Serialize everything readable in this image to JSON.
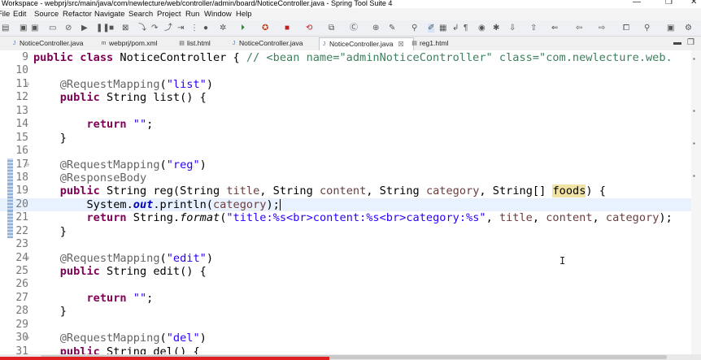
{
  "window": {
    "title": "Workspace - webprj/src/main/java/com/newlecture/web/controller/admin/board/NoticeController.java - Spring Tool Suite 4",
    "controls": [
      "—",
      "❐",
      "✕"
    ]
  },
  "menu": {
    "items": [
      "File",
      "Edit",
      "Source",
      "Refactor",
      "Navigate",
      "Search",
      "Project",
      "Run",
      "Window",
      "Help"
    ]
  },
  "tabs": [
    {
      "label": "NoticeController.java",
      "icon": "java-file-icon",
      "active": false
    },
    {
      "label": "webprj/pom.xml",
      "icon": "maven-file-icon",
      "active": false
    },
    {
      "label": "list.html",
      "icon": "html-file-icon",
      "active": false
    },
    {
      "label": "NoticeController.java",
      "icon": "java-file-icon",
      "active": false
    },
    {
      "label": "NoticeController.java",
      "icon": "java-file-icon",
      "active": true,
      "close": "☒"
    },
    {
      "label": "reg1.html",
      "icon": "html-file-icon",
      "active": false
    }
  ],
  "editor": {
    "lines": [
      {
        "no": "9",
        "fold": "",
        "mark": false,
        "cur": false,
        "tokens": [
          [
            "kw",
            "public "
          ],
          [
            "kw",
            "class "
          ],
          [
            "",
            "NoticeController { "
          ],
          [
            "cmt",
            "// <bean name=\"adminNoticeController\" class=\"com.newlecture.web."
          ]
        ]
      },
      {
        "no": "10",
        "fold": "",
        "mark": false,
        "cur": false,
        "tokens": []
      },
      {
        "no": "11",
        "fold": "⊖",
        "mark": false,
        "cur": false,
        "tokens": [
          [
            "",
            "    "
          ],
          [
            "ann",
            "@RequestMapping"
          ],
          [
            "",
            "("
          ],
          [
            "str",
            "\"list\""
          ],
          [
            "",
            ")"
          ]
        ]
      },
      {
        "no": "12",
        "fold": "",
        "mark": false,
        "cur": false,
        "tokens": [
          [
            "",
            "    "
          ],
          [
            "kw",
            "public "
          ],
          [
            "",
            "String list() {"
          ]
        ]
      },
      {
        "no": "13",
        "fold": "",
        "mark": false,
        "cur": false,
        "tokens": []
      },
      {
        "no": "14",
        "fold": "",
        "mark": false,
        "cur": false,
        "tokens": [
          [
            "",
            "        "
          ],
          [
            "kw",
            "return "
          ],
          [
            "str",
            "\"\""
          ],
          [
            "",
            ";"
          ]
        ]
      },
      {
        "no": "15",
        "fold": "",
        "mark": false,
        "cur": false,
        "tokens": [
          [
            "",
            "    }"
          ]
        ]
      },
      {
        "no": "16",
        "fold": "",
        "mark": false,
        "cur": false,
        "tokens": []
      },
      {
        "no": "17",
        "fold": "⊖",
        "mark": true,
        "cur": false,
        "tokens": [
          [
            "",
            "    "
          ],
          [
            "ann",
            "@RequestMapping"
          ],
          [
            "",
            "("
          ],
          [
            "str",
            "\"reg\""
          ],
          [
            "",
            ")"
          ]
        ]
      },
      {
        "no": "18",
        "fold": "",
        "mark": true,
        "cur": false,
        "tokens": [
          [
            "",
            "    "
          ],
          [
            "ann",
            "@ResponseBody"
          ]
        ]
      },
      {
        "no": "19",
        "fold": "",
        "mark": true,
        "cur": false,
        "tokens": [
          [
            "",
            "    "
          ],
          [
            "kw",
            "public "
          ],
          [
            "",
            "String reg(String "
          ],
          [
            "var",
            "title"
          ],
          [
            "",
            ", String "
          ],
          [
            "var",
            "content"
          ],
          [
            "",
            ", String "
          ],
          [
            "var",
            "category"
          ],
          [
            "",
            ", String[] "
          ],
          [
            "occ",
            "foods"
          ],
          [
            "",
            ") {"
          ]
        ]
      },
      {
        "no": "20",
        "fold": "",
        "mark": true,
        "cur": true,
        "tokens": [
          [
            "",
            "        System."
          ],
          [
            "it",
            "out"
          ],
          [
            "",
            ".println("
          ],
          [
            "var",
            "category"
          ],
          [
            "",
            ");"
          ],
          [
            "caret",
            ""
          ]
        ]
      },
      {
        "no": "21",
        "fold": "",
        "mark": true,
        "cur": false,
        "tokens": [
          [
            "",
            "        "
          ],
          [
            "kw",
            "return "
          ],
          [
            "",
            "String."
          ],
          [
            "itn",
            "format"
          ],
          [
            "",
            "("
          ],
          [
            "str",
            "\"title:%s<br>content:%s<br>category:%s\""
          ],
          [
            "",
            ", "
          ],
          [
            "var",
            "title"
          ],
          [
            "",
            ", "
          ],
          [
            "var",
            "content"
          ],
          [
            "",
            ", "
          ],
          [
            "var",
            "category"
          ],
          [
            "",
            ");"
          ]
        ]
      },
      {
        "no": "22",
        "fold": "",
        "mark": true,
        "cur": false,
        "tokens": [
          [
            "",
            "    }"
          ]
        ]
      },
      {
        "no": "23",
        "fold": "",
        "mark": false,
        "cur": false,
        "tokens": []
      },
      {
        "no": "24",
        "fold": "⊖",
        "mark": false,
        "cur": false,
        "tokens": [
          [
            "",
            "    "
          ],
          [
            "ann",
            "@RequestMapping"
          ],
          [
            "",
            "("
          ],
          [
            "str",
            "\"edit\""
          ],
          [
            "",
            ")"
          ]
        ]
      },
      {
        "no": "25",
        "fold": "",
        "mark": false,
        "cur": false,
        "tokens": [
          [
            "",
            "    "
          ],
          [
            "kw",
            "public "
          ],
          [
            "",
            "String edit() {"
          ]
        ]
      },
      {
        "no": "26",
        "fold": "",
        "mark": false,
        "cur": false,
        "tokens": []
      },
      {
        "no": "27",
        "fold": "",
        "mark": false,
        "cur": false,
        "tokens": [
          [
            "",
            "        "
          ],
          [
            "kw",
            "return "
          ],
          [
            "str",
            "\"\""
          ],
          [
            "",
            ";"
          ]
        ]
      },
      {
        "no": "28",
        "fold": "",
        "mark": false,
        "cur": false,
        "tokens": [
          [
            "",
            "    }"
          ]
        ]
      },
      {
        "no": "29",
        "fold": "",
        "mark": false,
        "cur": false,
        "tokens": []
      },
      {
        "no": "30",
        "fold": "⊖",
        "mark": false,
        "cur": false,
        "tokens": [
          [
            "",
            "    "
          ],
          [
            "ann",
            "@RequestMapping"
          ],
          [
            "",
            "("
          ],
          [
            "str",
            "\"del\""
          ],
          [
            "",
            ")"
          ]
        ]
      },
      {
        "no": "31",
        "fold": "",
        "mark": false,
        "cur": false,
        "tokens": [
          [
            "",
            "    "
          ],
          [
            "kw",
            "public "
          ],
          [
            "",
            "String del() {"
          ]
        ]
      }
    ]
  },
  "colors": {
    "keyword": "#7f0055",
    "string": "#2a00ff",
    "annotation": "#646464",
    "comment": "#3f7f5f",
    "local_variable": "#6a3e3e",
    "static_field": "#0000c0",
    "current_line": "#e8f2fe",
    "occurrence": "#f0e3a4",
    "progress_bar": "#e02020"
  },
  "video_progress": {
    "fraction": 0.47
  }
}
